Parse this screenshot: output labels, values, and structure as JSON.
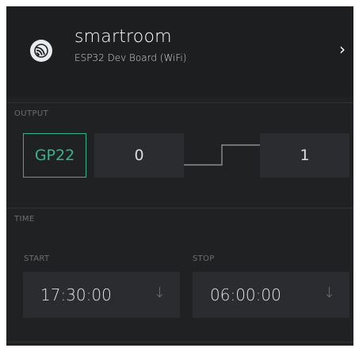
{
  "device": {
    "name": "smartroom",
    "board": "ESP32 Dev Board (WiFi)",
    "icon": "espressif-icon",
    "chevron": "›"
  },
  "output": {
    "label": "OUTPUT",
    "pin": "GP22",
    "low_value": "0",
    "high_value": "1"
  },
  "time": {
    "label": "TIME",
    "start": {
      "label": "START",
      "value": "17:30:00",
      "arrow": "↓"
    },
    "stop": {
      "label": "STOP",
      "value": "06:00:00",
      "arrow": "↓"
    }
  },
  "colors": {
    "accent": "#34b48b",
    "panel": "#202123",
    "box": "#2b2c30"
  }
}
